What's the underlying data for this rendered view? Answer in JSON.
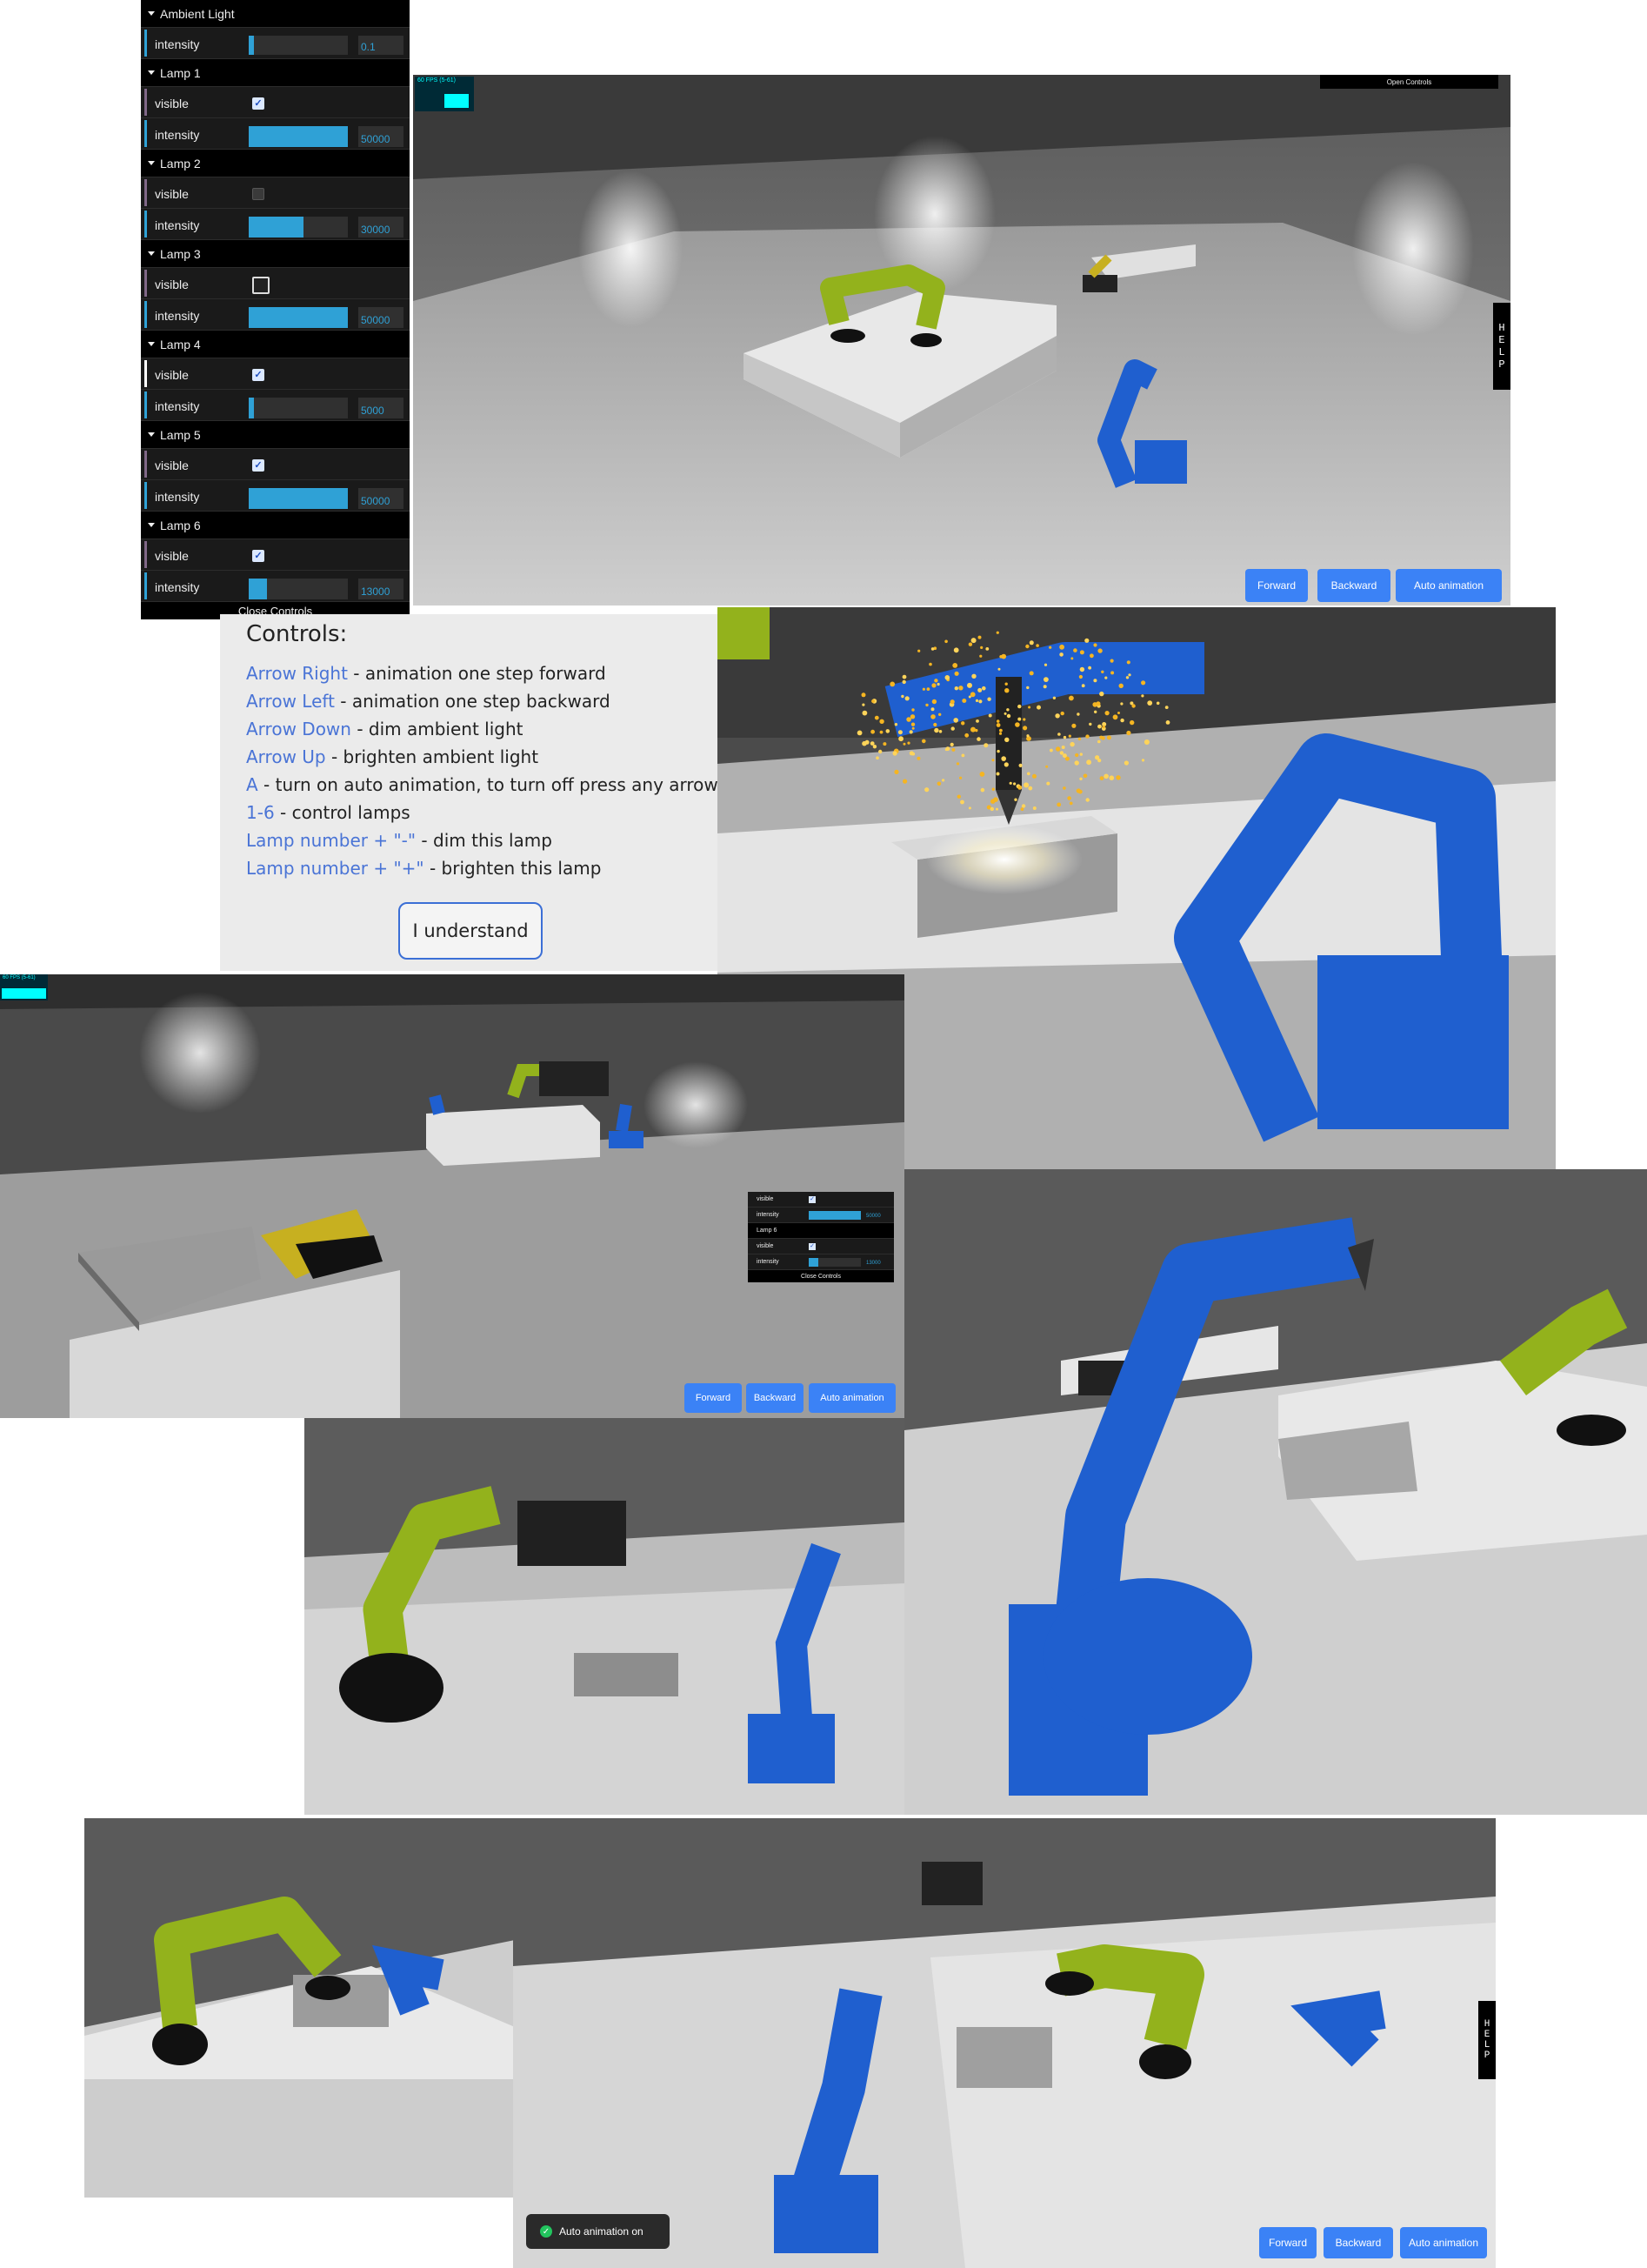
{
  "gui": {
    "ambient": {
      "title": "Ambient Light",
      "intensity_label": "intensity",
      "intensity_value": "0.1",
      "intensity_fraction": 0.05
    },
    "lamps": [
      {
        "title": "Lamp 1",
        "visible_label": "visible",
        "visible": true,
        "intensity_label": "intensity",
        "intensity_value": "50000",
        "intensity_fraction": 1.0
      },
      {
        "title": "Lamp 2",
        "visible_label": "visible",
        "visible": false,
        "intensity_label": "intensity",
        "intensity_value": "30000",
        "intensity_fraction": 0.55
      },
      {
        "title": "Lamp 3",
        "visible_label": "visible",
        "visible": false,
        "intensity_label": "intensity",
        "intensity_value": "50000",
        "intensity_fraction": 1.0
      },
      {
        "title": "Lamp 4",
        "visible_label": "visible",
        "visible": true,
        "intensity_label": "intensity",
        "intensity_value": "5000",
        "intensity_fraction": 0.0
      },
      {
        "title": "Lamp 5",
        "visible_label": "visible",
        "visible": true,
        "intensity_label": "intensity",
        "intensity_value": "50000",
        "intensity_fraction": 1.0
      },
      {
        "title": "Lamp 6",
        "visible_label": "visible",
        "visible": true,
        "intensity_label": "intensity",
        "intensity_value": "13000",
        "intensity_fraction": 0.18
      }
    ],
    "close_label": "Close Controls"
  },
  "mini_gui": {
    "rows": [
      {
        "kind": "checkbox",
        "label": "visible",
        "checked": true
      },
      {
        "kind": "slider",
        "label": "intensity",
        "value": "50000",
        "fraction": 1.0
      },
      {
        "kind": "title",
        "label": "Lamp 6"
      },
      {
        "kind": "checkbox",
        "label": "visible",
        "checked": true
      },
      {
        "kind": "slider",
        "label": "intensity",
        "value": "13000",
        "fraction": 0.18
      }
    ],
    "close_label": "Close Controls"
  },
  "fps": {
    "label_1": "60 FPS (5-61)",
    "label_2": "60 FPS (5-61)"
  },
  "open_controls": "Open Controls",
  "help_letters": [
    "H",
    "E",
    "L",
    "P"
  ],
  "buttons": {
    "forward": "Forward",
    "backward": "Backward",
    "auto": "Auto animation"
  },
  "controls": {
    "title": "Controls:",
    "lines": [
      {
        "key": "Arrow Right",
        "desc": " - animation one step forward"
      },
      {
        "key": "Arrow Left",
        "desc": " - animation one step backward"
      },
      {
        "key": "Arrow Down",
        "desc": " - dim ambient light"
      },
      {
        "key": "Arrow Up",
        "desc": " - brighten ambient light"
      },
      {
        "key": "A",
        "desc": " - turn on auto animation, to turn off press any arrow"
      },
      {
        "key": "1-6",
        "desc": " - control lamps"
      },
      {
        "key": "Lamp number + \"-\"",
        "desc": " - dim this lamp"
      },
      {
        "key": "Lamp number + \"+\"",
        "desc": " - brighten this lamp"
      }
    ],
    "ok_label": "I understand"
  },
  "toast": {
    "text": "Auto animation on"
  },
  "colors": {
    "accent": "#3b82f6",
    "gui_bg": "#1a1a1a",
    "slider_fill": "#2fa1d6",
    "robot_blue": "#1f5fcf",
    "robot_green": "#93b21c",
    "link": "#4a74d6"
  }
}
